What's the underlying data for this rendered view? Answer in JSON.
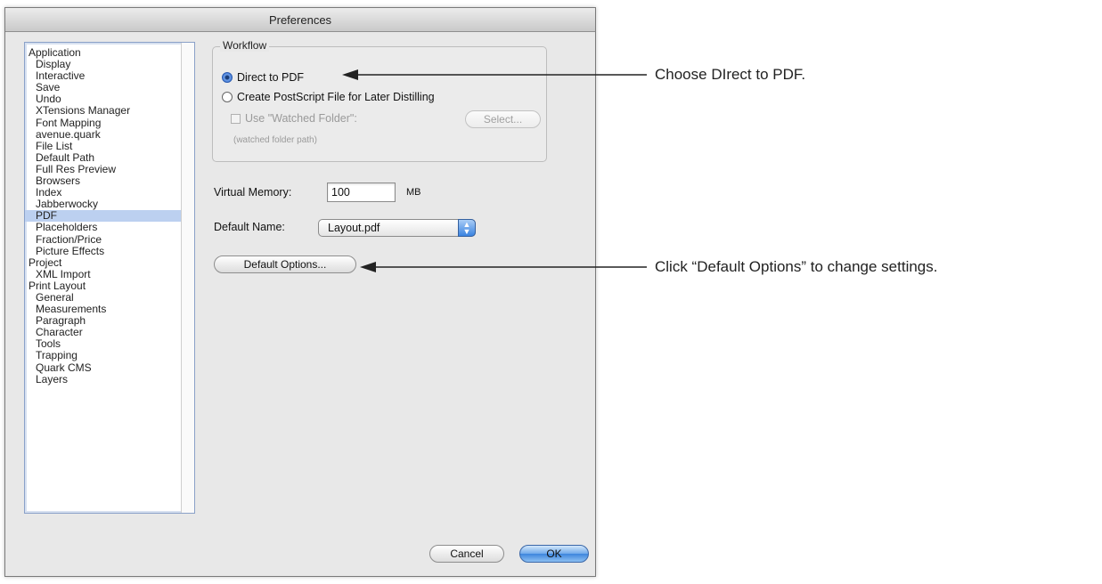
{
  "window": {
    "title": "Preferences"
  },
  "sidebar": {
    "items": [
      {
        "label": "Application",
        "level": 0
      },
      {
        "label": "Display",
        "level": 1
      },
      {
        "label": "Interactive",
        "level": 1
      },
      {
        "label": "Save",
        "level": 1
      },
      {
        "label": "Undo",
        "level": 1
      },
      {
        "label": "XTensions Manager",
        "level": 1
      },
      {
        "label": "Font Mapping",
        "level": 1
      },
      {
        "label": "avenue.quark",
        "level": 1
      },
      {
        "label": "File List",
        "level": 1
      },
      {
        "label": "Default Path",
        "level": 1
      },
      {
        "label": "Full Res Preview",
        "level": 1
      },
      {
        "label": "Browsers",
        "level": 1
      },
      {
        "label": "Index",
        "level": 1
      },
      {
        "label": "Jabberwocky",
        "level": 1
      },
      {
        "label": "PDF",
        "level": 1,
        "selected": true
      },
      {
        "label": "Placeholders",
        "level": 1
      },
      {
        "label": "Fraction/Price",
        "level": 1
      },
      {
        "label": "Picture Effects",
        "level": 1
      },
      {
        "label": "Project",
        "level": 0
      },
      {
        "label": "XML Import",
        "level": 1
      },
      {
        "label": "Print Layout",
        "level": 0
      },
      {
        "label": "General",
        "level": 1
      },
      {
        "label": "Measurements",
        "level": 1
      },
      {
        "label": "Paragraph",
        "level": 1
      },
      {
        "label": "Character",
        "level": 1
      },
      {
        "label": "Tools",
        "level": 1
      },
      {
        "label": "Trapping",
        "level": 1
      },
      {
        "label": "Quark CMS",
        "level": 1
      },
      {
        "label": "Layers",
        "level": 1
      }
    ]
  },
  "workflow": {
    "group_label": "Workflow",
    "direct_to_pdf": "Direct to PDF",
    "create_postscript": "Create PostScript File for Later Distilling",
    "use_watched_folder": "Use \"Watched Folder\":",
    "select_button": "Select...",
    "watched_folder_path": "(watched folder path)"
  },
  "memory": {
    "label": "Virtual Memory:",
    "value": "100",
    "unit": "MB"
  },
  "default_name": {
    "label": "Default Name:",
    "value": "Layout.pdf"
  },
  "default_options_button": "Default Options...",
  "footer": {
    "cancel": "Cancel",
    "ok": "OK"
  },
  "callouts": {
    "direct_pdf": "Choose DIrect to PDF.",
    "default_options": "Click “Default Options” to change settings."
  },
  "colors": {
    "selection": "#bcd0f0",
    "accent_blue": "#3d86dd"
  }
}
